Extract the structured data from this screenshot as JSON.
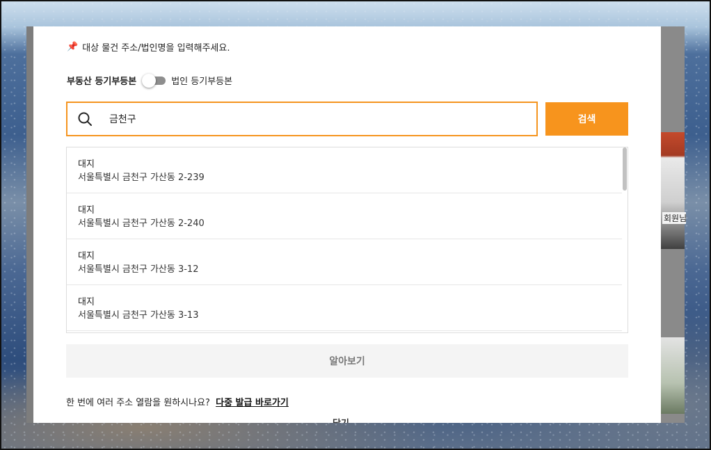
{
  "modal": {
    "notice": "대상 물건 주소/법인명을 입력해주세요.",
    "notice_icon": "pushpin-icon",
    "toggle": {
      "left_label": "부동산 등기부등본",
      "right_label": "법인 등기부등본",
      "state": "off"
    },
    "search": {
      "value": "금천구",
      "icon": "search-icon",
      "button_label": "검색"
    },
    "results": [
      {
        "type": "대지",
        "address": "서울특별시 금천구 가산동 2-239"
      },
      {
        "type": "대지",
        "address": "서울특별시 금천구 가산동 2-240"
      },
      {
        "type": "대지",
        "address": "서울특별시 금천구 가산동 3-12"
      },
      {
        "type": "대지",
        "address": "서울특별시 금천구 가산동 3-13"
      }
    ],
    "learn_button": "알아보기",
    "multi_prompt": "한 번에 여러 주소 열람을 원하시나요?",
    "multi_link": "다중 발급 바로가기",
    "close_label": "닫기"
  },
  "background": {
    "side_text": "회원님"
  },
  "colors": {
    "accent": "#f7941d",
    "pin": "#e0334f"
  }
}
